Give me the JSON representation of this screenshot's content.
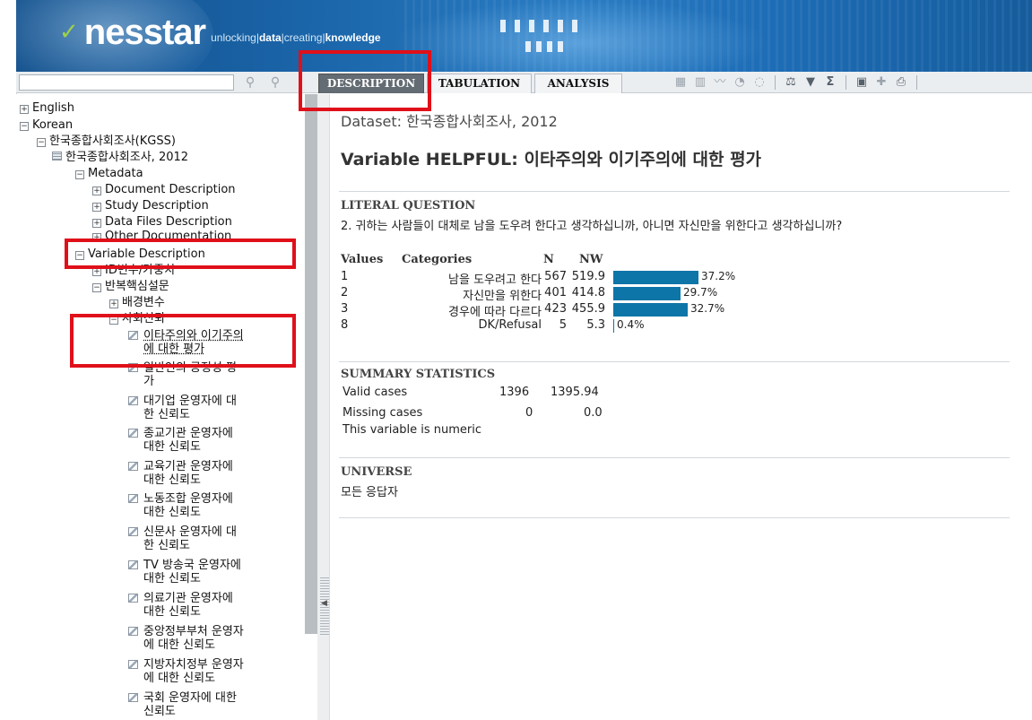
{
  "header": {
    "logo_text": "nesstar",
    "tagline_1": "unlocking",
    "tagline_2": "data",
    "tagline_3": "creating",
    "tagline_4": "knowledge"
  },
  "search": {
    "placeholder": "",
    "value": ""
  },
  "tabs": [
    {
      "label": "DESCRIPTION",
      "active": true
    },
    {
      "label": "TABULATION",
      "active": false
    },
    {
      "label": "ANALYSIS",
      "active": false
    }
  ],
  "toolbar_icons": [
    "table-icon",
    "bar-chart-icon",
    "line-chart-icon",
    "pie-chart-icon",
    "map-icon",
    "weight-icon",
    "filter-icon",
    "sigma-icon",
    "save-icon",
    "bookmark-icon",
    "print-icon"
  ],
  "sidebar": {
    "english": "English",
    "korean": "Korean",
    "kgss": "한국종합사회조사(KGSS)",
    "dataset_2012": "한국종합사회조사, 2012",
    "metadata": "Metadata",
    "document_description": "Document Description",
    "study_description": "Study Description",
    "data_files_description": "Data Files Description",
    "other_documentation": "Other Documentation",
    "variable_description": "Variable Description",
    "id_group": "ID변수/가중치",
    "core_module": "반복핵심설문",
    "background_vars": "배경변수",
    "social_trust": "사회신뢰",
    "variables": [
      [
        "이타주의와 이기주의",
        "에 대한 평가"
      ],
      [
        "일반인의 공정성 평",
        "가"
      ],
      [
        "대기업 운영자에 대",
        "한 신뢰도"
      ],
      [
        "종교기관 운영자에",
        "대한 신뢰도"
      ],
      [
        "교육기관 운영자에",
        "대한 신뢰도"
      ],
      [
        "노동조합 운영자에",
        "대한 신뢰도"
      ],
      [
        "신문사 운영자에 대",
        "한 신뢰도"
      ],
      [
        "TV 방송국 운영자에",
        "대한 신뢰도"
      ],
      [
        "의료기관 운영자에",
        "대한 신뢰도"
      ],
      [
        "중앙정부부처 운영자",
        "에 대한 신뢰도"
      ],
      [
        "지방자치정부 운영자",
        "에 대한 신뢰도"
      ],
      [
        "국회 운영자에 대한",
        "신뢰도"
      ]
    ]
  },
  "main": {
    "dataset_label": "Dataset: 한국종합사회조사, 2012",
    "variable_prefix": "Variable HELPFUL:",
    "variable_label": "이타주의와 이기주의에 대한 평가",
    "literal_question_head": "LITERAL QUESTION",
    "literal_question": "2. 귀하는 사람들이 대체로 남을 도우려 한다고 생각하십니까, 아니면 자신만을 위한다고 생각하십니까?",
    "frequency": {
      "headers": {
        "values": "Values",
        "categories": "Categories",
        "n": "N",
        "nw": "NW"
      },
      "rows": [
        {
          "value": "1",
          "category": "남을 도우려고 한다",
          "n": "567",
          "nw": "519.9",
          "pct": 37.2,
          "pct_label": "37.2%"
        },
        {
          "value": "2",
          "category": "자신만을 위한다",
          "n": "401",
          "nw": "414.8",
          "pct": 29.7,
          "pct_label": "29.7%"
        },
        {
          "value": "3",
          "category": "경우에 따라 다르다",
          "n": "423",
          "nw": "455.9",
          "pct": 32.7,
          "pct_label": "32.7%"
        },
        {
          "value": "8",
          "category": "DK/Refusal",
          "n": "5",
          "nw": "5.3",
          "pct": 0.4,
          "pct_label": "0.4%"
        }
      ]
    },
    "summary_head": "SUMMARY STATISTICS",
    "summary": {
      "valid_label": "Valid cases",
      "valid_n": "1396",
      "valid_nw": "1395.94",
      "missing_label": "Missing cases",
      "missing_n": "0",
      "missing_nw": "0.0",
      "numeric_note": "This variable is numeric"
    },
    "universe_head": "UNIVERSE",
    "universe": "모든 응답자"
  },
  "colors": {
    "bar": "#0e75a8",
    "annotation": "#e0101a",
    "active_tab": "#636b73"
  }
}
